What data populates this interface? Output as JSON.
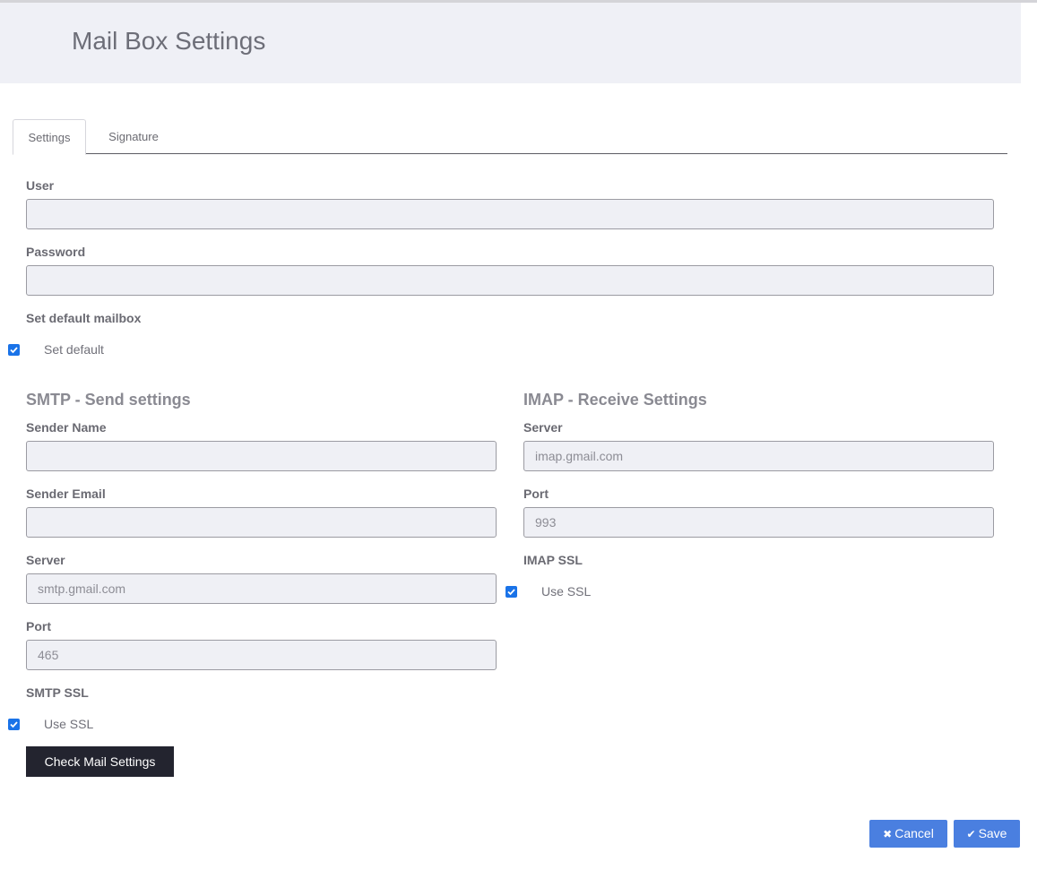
{
  "header": {
    "title": "Mail Box Settings"
  },
  "tabs": [
    {
      "label": "Settings",
      "active": true
    },
    {
      "label": "Signature",
      "active": false
    }
  ],
  "form": {
    "user": {
      "label": "User",
      "value": ""
    },
    "password": {
      "label": "Password",
      "value": ""
    },
    "default_mailbox": {
      "label": "Set default mailbox",
      "checkbox_label": "Set default",
      "checked": true
    }
  },
  "smtp": {
    "title": "SMTP - Send settings",
    "sender_name": {
      "label": "Sender Name",
      "value": ""
    },
    "sender_email": {
      "label": "Sender Email",
      "value": ""
    },
    "server": {
      "label": "Server",
      "value": "smtp.gmail.com"
    },
    "port": {
      "label": "Port",
      "value": "465"
    },
    "ssl": {
      "label": "SMTP SSL",
      "checkbox_label": "Use SSL",
      "checked": true
    }
  },
  "imap": {
    "title": "IMAP - Receive Settings",
    "server": {
      "label": "Server",
      "value": "imap.gmail.com"
    },
    "port": {
      "label": "Port",
      "value": "993"
    },
    "ssl": {
      "label": "IMAP SSL",
      "checkbox_label": "Use SSL",
      "checked": true
    }
  },
  "buttons": {
    "check": "Check Mail Settings",
    "cancel": "Cancel",
    "save": "Save"
  },
  "colors": {
    "header_bg": "#eff0f6",
    "checkbox": "#1a73e8",
    "primary_button": "#4a7fe0",
    "dark_button": "#23242f"
  }
}
